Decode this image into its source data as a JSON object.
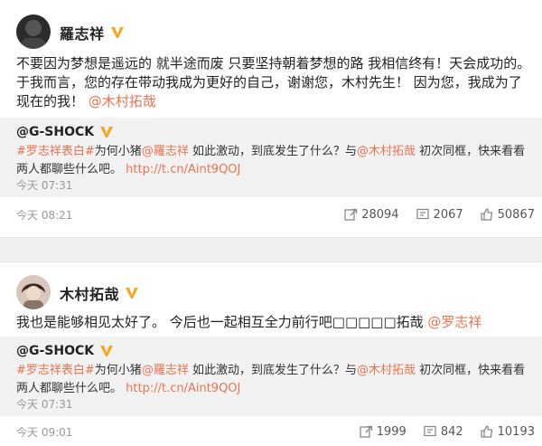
{
  "posts": [
    {
      "user": "羅志祥",
      "text_plain": "不要因为梦想是遥远的 就半途而废 只要坚持朝着梦想的路 我相信终有！天会成功的。 于我而言，您的存在带动我成为更好的自己，谢谢您，木村先生！ 因为您，我成为了现在的我！ ",
      "mention": "@木村拓哉",
      "repost": {
        "user": "@G-SHOCK",
        "hashtag": "#罗志祥表白#",
        "text_a": "为何小猪",
        "mention_a": "@羅志祥",
        "text_b": " 如此激动，到底发生了什么？与",
        "mention_b": "@木村拓哉",
        "text_c": " 初次同框，快来看看两人都聊些什么吧。 ",
        "link": "http://t.cn/Aint9QOJ",
        "time": "今天 07:31"
      },
      "time": "今天 08:21",
      "actions": {
        "repost_count": "28094",
        "comment_count": "2067",
        "like_count": "50867"
      }
    },
    {
      "user": "木村拓哉",
      "text_plain": "我也是能够相见太好了。 今后也一起相互全力前行吧□□□□□拓哉 ",
      "mention": "@罗志祥",
      "repost": {
        "user": "@G-SHOCK",
        "hashtag": "#罗志祥表白#",
        "text_a": "为何小猪",
        "mention_a": "@羅志祥",
        "text_b": " 如此激动，到底发生了什么？与",
        "mention_b": "@木村拓哉",
        "text_c": " 初次同框，快来看看两人都聊些什么吧。 ",
        "link": "http://t.cn/Aint9QOJ",
        "time": "今天 07:31"
      },
      "time": "今天 09:01",
      "actions": {
        "repost_count": "1999",
        "comment_count": "842",
        "like_count": "10193"
      }
    }
  ],
  "colors": {
    "accent": "#eb7350",
    "repost_bg": "#f2f2f2",
    "gap_bg": "#f0f0f0",
    "vbadge": "#f5a623"
  }
}
